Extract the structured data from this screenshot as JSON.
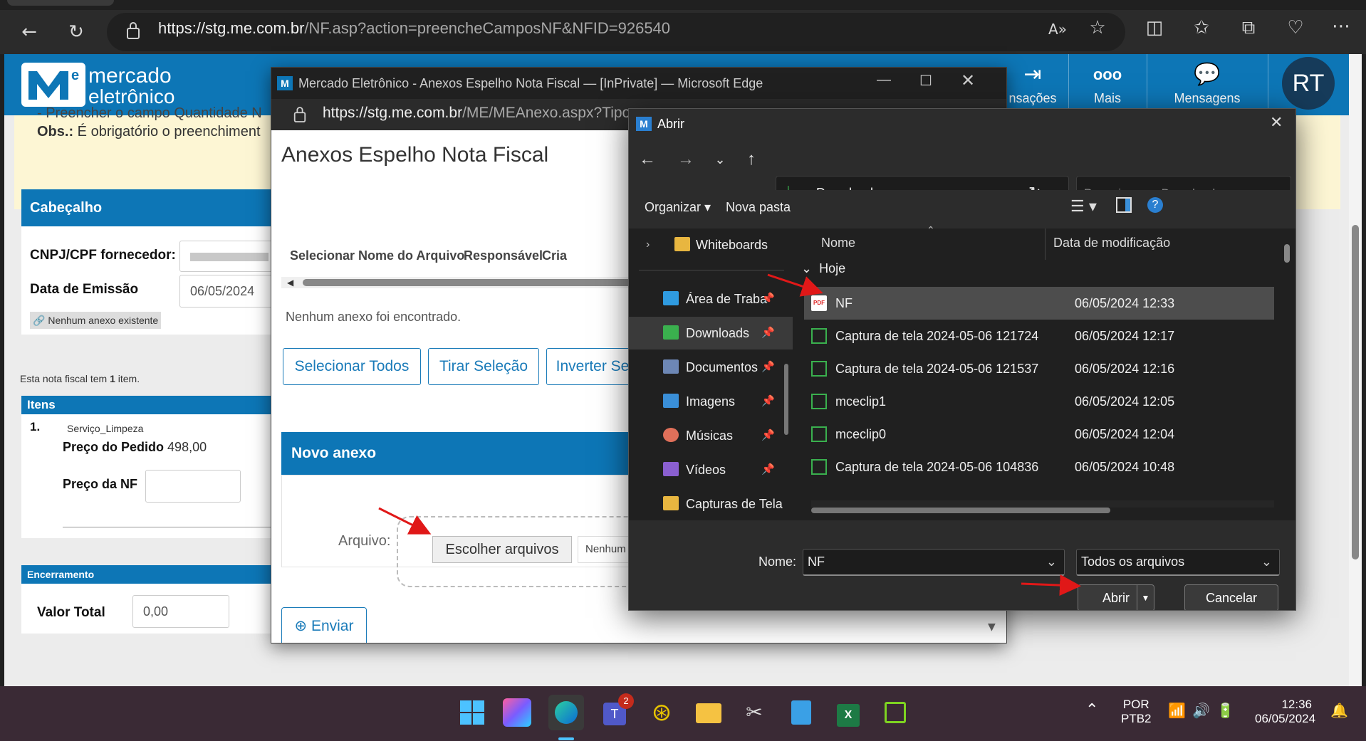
{
  "browser": {
    "url_host": "https://stg.me.com.br",
    "url_path": "/NF.asp?action=preencheCamposNF&NFID=926540"
  },
  "site": {
    "logo_line1": "mercado",
    "logo_line2": "eletrônico",
    "nav": [
      {
        "label": "nsações",
        "icon": "export-icon"
      },
      {
        "label": "Mais",
        "icon": "more-icon"
      },
      {
        "label": "Mensagens",
        "icon": "chat-icon"
      }
    ],
    "avatar_initials": "RT",
    "notice_line1": "- Preencher o campo Quantidade N",
    "notice_obs_label": "Obs.:",
    "notice_line2": " É obrigatório o preenchiment"
  },
  "header_card": {
    "title": "Cabeçalho",
    "cnpj_label": "CNPJ/CPF fornecedor:",
    "data_emissao_label": "Data de Emissão",
    "data_emissao_value": "06/05/2024",
    "attachment_text": "Nenhum anexo existente"
  },
  "items_info": {
    "prefix": "Esta nota fiscal tem ",
    "count": "1",
    "suffix": " item."
  },
  "items_card": {
    "title": "Itens",
    "index": "1.",
    "item_name": "Serviço_Limpeza",
    "preco_pedido_label": "Preço do Pedido",
    "preco_pedido_value": "498,00",
    "preco_nf_label": "Preço da NF"
  },
  "closing_card": {
    "title": "Encerramento",
    "valor_total_label": "Valor Total",
    "valor_total_value": "0,00"
  },
  "popup": {
    "title": "Mercado Eletrônico - Anexos Espelho Nota Fiscal — [InPrivate] — Microsoft Edge",
    "url_host": "https://stg.me.com.br",
    "url_path": "/ME/MEAnexo.aspx?Tipo",
    "heading": "Anexos Espelho Nota Fiscal",
    "columns": [
      "Selecionar",
      "Nome do Arquivo",
      "Responsável",
      "Cria"
    ],
    "empty_text": "Nenhum anexo foi encontrado.",
    "btn_select_all": "Selecionar Todos",
    "btn_clear": "Tirar Seleção",
    "btn_invert": "Inverter Se",
    "novo_anexo": "Novo anexo",
    "arquivo_label": "Arquivo:",
    "choose_files": "Escolher arquivos",
    "no_file": "Nenhum",
    "enviar": "Enviar"
  },
  "dialog": {
    "title": "Abrir",
    "breadcrumb": "Downloads",
    "search_placeholder": "Pesquisar em Downloads",
    "organize": "Organizar",
    "new_folder": "Nova pasta",
    "col_name": "Nome",
    "col_date": "Data de modificação",
    "group_today": "Hoje",
    "sidebar": [
      {
        "label": "Whiteboards",
        "color": "#e8b640",
        "pinned": false
      },
      {
        "label": "Área de Traba",
        "color": "#2f9be0",
        "pinned": true
      },
      {
        "label": "Downloads",
        "color": "#3ab04e",
        "pinned": true
      },
      {
        "label": "Documentos",
        "color": "#6d87b5",
        "pinned": true
      },
      {
        "label": "Imagens",
        "color": "#3a8fd8",
        "pinned": true
      },
      {
        "label": "Músicas",
        "color": "#e0705a",
        "pinned": true
      },
      {
        "label": "Vídeos",
        "color": "#8a5fd0",
        "pinned": true
      },
      {
        "label": "Capturas de Tela",
        "color": "#e8b640",
        "pinned": false
      }
    ],
    "files": [
      {
        "name": "NF",
        "date": "06/05/2024 12:33",
        "type": "pdf"
      },
      {
        "name": "Captura de tela 2024-05-06 121724",
        "date": "06/05/2024 12:17",
        "type": "img"
      },
      {
        "name": "Captura de tela 2024-05-06 121537",
        "date": "06/05/2024 12:16",
        "type": "img"
      },
      {
        "name": "mceclip1",
        "date": "06/05/2024 12:05",
        "type": "img"
      },
      {
        "name": "mceclip0",
        "date": "06/05/2024 12:04",
        "type": "img"
      },
      {
        "name": "Captura de tela 2024-05-06 104836",
        "date": "06/05/2024 10:48",
        "type": "img"
      }
    ],
    "name_label": "Nome:",
    "name_value": "NF",
    "filter_value": "Todos os arquivos",
    "open_btn": "Abrir",
    "cancel_btn": "Cancelar"
  },
  "taskbar": {
    "teams_badge": "2",
    "lang_line1": "POR",
    "lang_line2": "PTB2",
    "time": "12:36",
    "date": "06/05/2024"
  }
}
